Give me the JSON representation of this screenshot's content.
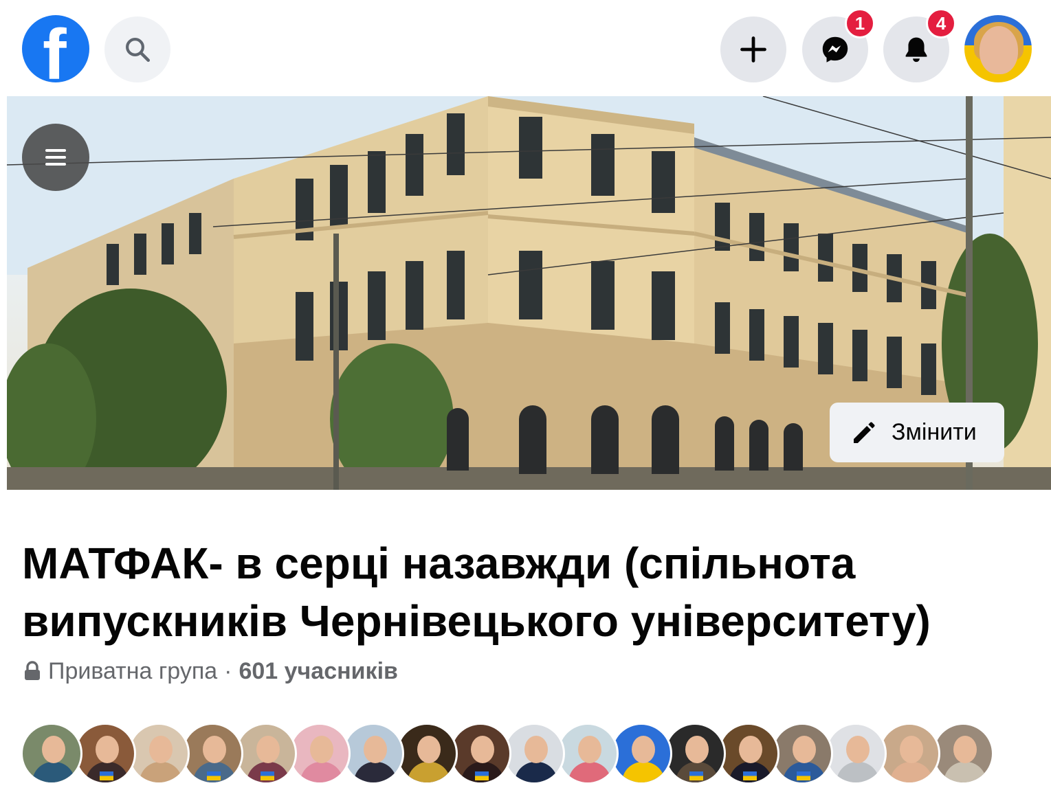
{
  "topbar": {
    "logo_letter": "f",
    "icons": {
      "search": "search-icon",
      "plus": "plus-icon",
      "messenger": "messenger-icon",
      "bell": "bell-icon"
    },
    "messenger_badge": "1",
    "notifications_badge": "4"
  },
  "cover": {
    "edit_label": "Змінити"
  },
  "group": {
    "title": "МАТФАК- в серці назавжди (спільнота випускників Чернівецького університету)",
    "privacy": "Приватна група",
    "separator": "·",
    "members": "601 учасників"
  },
  "member_avatars": [
    {
      "bg": "#7a8a6a",
      "body": "#2b5a7a",
      "flag": false
    },
    {
      "bg": "#8a5a3a",
      "body": "#3a2a2a",
      "flag": true
    },
    {
      "bg": "#d9c7b0",
      "body": "#c9a27a",
      "flag": false
    },
    {
      "bg": "#9a7a5a",
      "body": "#4a6a8a",
      "flag": true
    },
    {
      "bg": "#c9b59a",
      "body": "#7a3a4a",
      "flag": true
    },
    {
      "bg": "#e9b7c0",
      "body": "#e08aa0",
      "flag": false
    },
    {
      "bg": "#b7c9d9",
      "body": "#2a2a3a",
      "flag": false
    },
    {
      "bg": "#3a2a1a",
      "body": "#c9a030",
      "flag": false
    },
    {
      "bg": "#5a3a2a",
      "body": "#2a1a1a",
      "flag": true
    },
    {
      "bg": "#d9dde2",
      "body": "#1a2a4a",
      "flag": false
    },
    {
      "bg": "#c9d9e0",
      "body": "#e06a7a",
      "flag": false
    },
    {
      "bg": "#2b6fd8",
      "body": "#f5c400",
      "flag": false
    },
    {
      "bg": "#2a2a2a",
      "body": "#5a4a3a",
      "flag": true
    },
    {
      "bg": "#6a4a2a",
      "body": "#1a1a2a",
      "flag": true
    },
    {
      "bg": "#8a7a6a",
      "body": "#2b5a9a",
      "flag": true
    },
    {
      "bg": "#dfe1e5",
      "body": "#bcc0c4",
      "flag": false
    },
    {
      "bg": "#c9a98a",
      "body": "#e0b090",
      "flag": false
    },
    {
      "bg": "#9a8a7a",
      "body": "#c9c0b0",
      "flag": false
    }
  ],
  "colors": {
    "brand": "#1877f2",
    "badge": "#e41e3f",
    "text": "#050505",
    "secondary_text": "#65676b"
  }
}
